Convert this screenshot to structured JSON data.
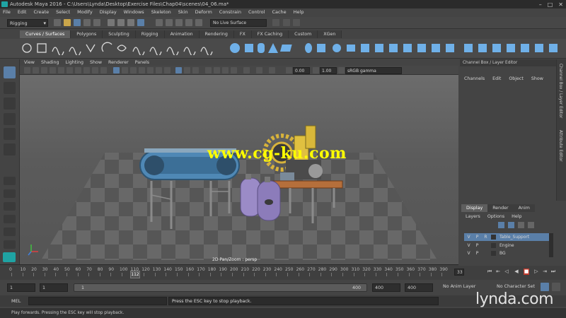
{
  "window": {
    "title": "Autodesk Maya 2016 - C:\\Users\\Lynda\\Desktop\\Exercise Files\\Chap04\\scenes\\04_06.ma*",
    "controls": [
      "–",
      "□",
      "✕"
    ]
  },
  "menubar": [
    "File",
    "Edit",
    "Create",
    "Select",
    "Modify",
    "Display",
    "Windows",
    "Skeleton",
    "Skin",
    "Deform",
    "Constrain",
    "Control",
    "Cache",
    "Help"
  ],
  "toolbar": {
    "mode": "Rigging",
    "live_surface": "No Live Surface"
  },
  "shelf_tabs": [
    {
      "label": "Curves / Surfaces",
      "active": true
    },
    {
      "label": "Polygons"
    },
    {
      "label": "Sculpting"
    },
    {
      "label": "Rigging"
    },
    {
      "label": "Animation"
    },
    {
      "label": "Rendering"
    },
    {
      "label": "FX"
    },
    {
      "label": "FX Caching"
    },
    {
      "label": "Custom"
    },
    {
      "label": "XGen"
    }
  ],
  "panel_menu": [
    "View",
    "Shading",
    "Lighting",
    "Show",
    "Renderer",
    "Panels"
  ],
  "panel_toolbar": {
    "exposure": "0.00",
    "gamma": "1.00",
    "color_space": "sRGB gamma"
  },
  "viewport": {
    "label": "2D Pan/Zoom : persp",
    "watermark": "www.cg-ku.com"
  },
  "channel_box": {
    "header": "Channel Box / Layer Editor",
    "menu": [
      "Channels",
      "Edit",
      "Object",
      "Show"
    ],
    "side_tabs": [
      "Channel Box / Layer Editor",
      "Attribute Editor"
    ]
  },
  "layer_editor": {
    "tabs": [
      {
        "label": "Display",
        "active": true
      },
      {
        "label": "Render"
      },
      {
        "label": "Anim"
      }
    ],
    "menu": [
      "Layers",
      "Options",
      "Help"
    ],
    "layers": [
      {
        "v": "V",
        "p": "P",
        "r": "R",
        "name": "Table_Support",
        "selected": true
      },
      {
        "v": "V",
        "p": "P",
        "r": "",
        "name": "Engine",
        "selected": false
      },
      {
        "v": "V",
        "p": "P",
        "r": "",
        "name": "BG",
        "selected": false
      }
    ]
  },
  "timeline": {
    "ticks": [
      "0",
      "10",
      "20",
      "30",
      "40",
      "50",
      "60",
      "70",
      "80",
      "90",
      "100",
      "110",
      "120",
      "130",
      "140",
      "150",
      "160",
      "170",
      "180",
      "190",
      "200",
      "210",
      "220",
      "230",
      "240",
      "250",
      "260",
      "270",
      "280",
      "290",
      "300",
      "310",
      "320",
      "330",
      "340",
      "350",
      "360",
      "370",
      "380",
      "390"
    ],
    "current_frame": "112",
    "current_field": "33"
  },
  "range": {
    "start": "1",
    "playback_start": "1",
    "slider_start": "1",
    "slider_end": "400",
    "playback_end": "400",
    "end": "400",
    "anim_layer": "No Anim Layer",
    "char_set": "No Character Set"
  },
  "command_line": {
    "mel_label": "MEL",
    "result": "Press the ESC key to stop playback."
  },
  "help_line": "Play forwards. Pressing the ESC key will stop playback.",
  "branding": {
    "lynda": "lynda.com"
  }
}
